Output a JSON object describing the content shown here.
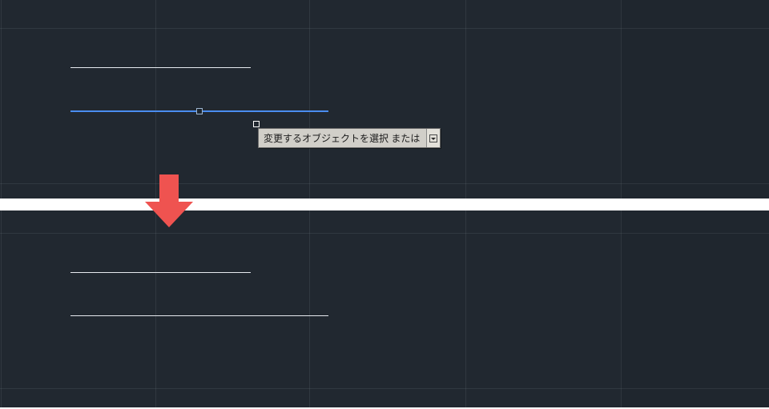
{
  "tooltip": {
    "text": "変更するオブジェクトを選択 または"
  },
  "icons": {
    "dropdown": "dropdown-icon",
    "arrow": "down-arrow-icon"
  }
}
